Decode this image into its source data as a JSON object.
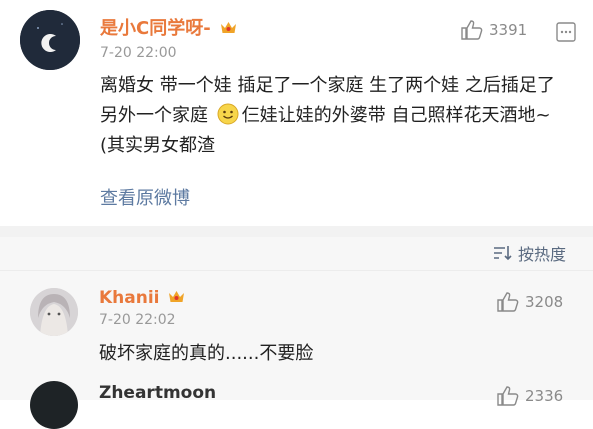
{
  "comments": [
    {
      "user": "是小C同学呀-",
      "time": "7-20 22:00",
      "likes": "3391",
      "content_part1": "离婚女 带一个娃 插足了一个家庭 生了两个娃 之后插足了另外一个家庭",
      "content_part2": "仨娃让娃的外婆带 自己照样花天酒地~ (其实男女都渣",
      "view_original": "查看原微博",
      "badge_icon": "crown-badge-icon",
      "emoji_icon": "smile-emoji-icon"
    }
  ],
  "sort": {
    "label": "按热度",
    "icon": "sort-icon"
  },
  "replies": [
    {
      "user": "Khanii",
      "time": "7-20 22:02",
      "likes": "3208",
      "content": "破坏家庭的真的......不要脸",
      "badge_icon": "crown-badge-icon"
    },
    {
      "user": "Zheartmoon",
      "likes": "2336"
    }
  ],
  "colors": {
    "vip_name": "#e9793c",
    "link": "#5d7aa1",
    "muted": "#999999",
    "section_bg": "#f7f7f7"
  }
}
